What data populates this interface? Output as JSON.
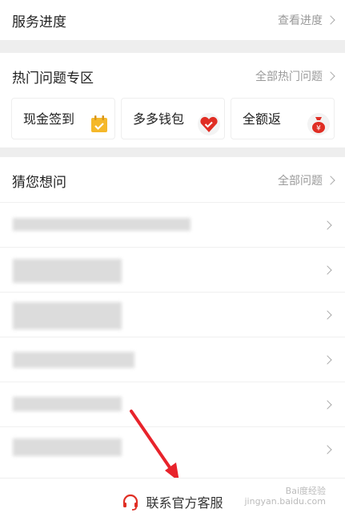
{
  "service_progress": {
    "title": "服务进度",
    "more": "查看进度"
  },
  "hot_questions": {
    "title": "热门问题专区",
    "more": "全部热门问题",
    "items": [
      {
        "label": "现金签到",
        "icon": "calendar-icon",
        "color": "#f5b82a"
      },
      {
        "label": "多多钱包",
        "icon": "wallet-heart-icon",
        "color": "#e02e24"
      },
      {
        "label": "全额返",
        "icon": "money-bag-icon",
        "color": "#e02e24"
      }
    ]
  },
  "guess": {
    "title": "猜您想问",
    "more": "全部问题"
  },
  "contact": {
    "label": "联系官方客服",
    "icon": "headset-icon",
    "color": "#e02e24"
  },
  "watermark": {
    "line1": "Bai度经验",
    "line2": "jingyan.baidu.com"
  }
}
